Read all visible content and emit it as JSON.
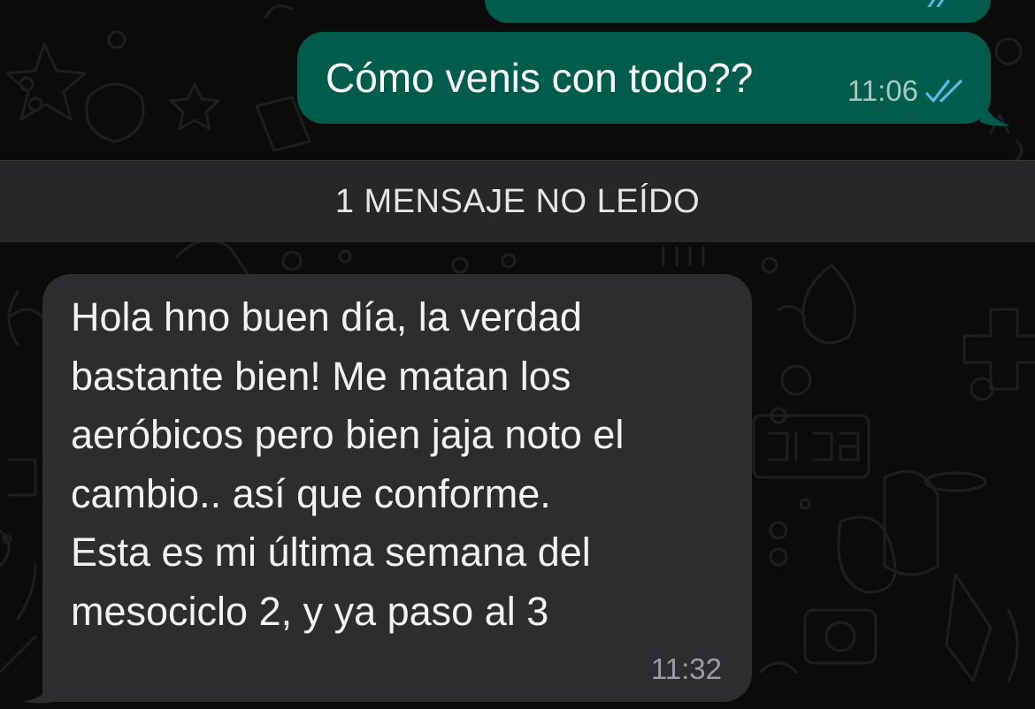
{
  "colors": {
    "background": "#0b0b0b",
    "outgoing_bubble": "#005c4b",
    "incoming_bubble": "#2d2d30",
    "unread_bar": "#27272a",
    "read_ticks": "#53bdeb"
  },
  "conversation": {
    "outgoing_messages": [
      {
        "text": "",
        "status_icon": "double-check-read-icon"
      },
      {
        "text": "Cómo venis con todo??",
        "time": "11:06",
        "status_icon": "double-check-read-icon"
      }
    ],
    "unread_divider": {
      "label": "1 MENSAJE NO LEÍDO"
    },
    "incoming_messages": [
      {
        "lines": [
          "Hola hno buen día, la verdad",
          "bastante bien! Me matan los",
          "aeróbicos pero bien jaja noto el",
          "cambio.. así que conforme.",
          "Esta es mi última semana del",
          "mesociclo 2, y ya paso al 3"
        ],
        "time": "11:32"
      }
    ]
  }
}
